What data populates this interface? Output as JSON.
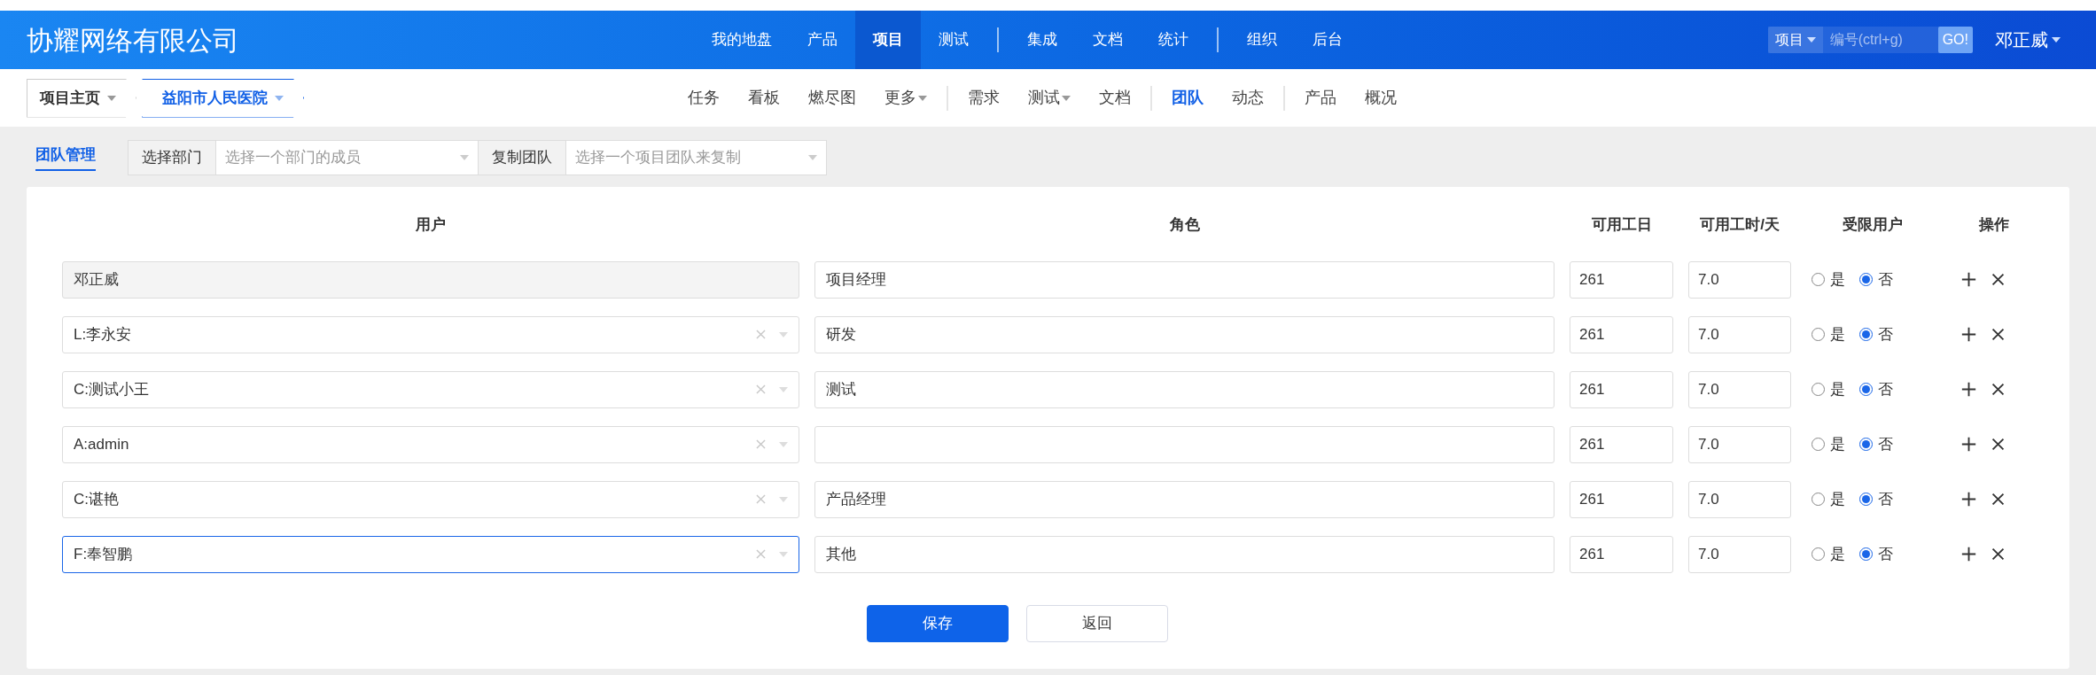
{
  "brand": "协耀网络有限公司",
  "main_nav": [
    [
      {
        "label": "我的地盘",
        "selected": false
      },
      {
        "label": "产品",
        "selected": false
      },
      {
        "label": "项目",
        "selected": true
      },
      {
        "label": "测试",
        "selected": false
      }
    ],
    [
      {
        "label": "集成",
        "selected": false
      },
      {
        "label": "文档",
        "selected": false
      },
      {
        "label": "统计",
        "selected": false
      }
    ],
    [
      {
        "label": "组织",
        "selected": false
      },
      {
        "label": "后台",
        "selected": false
      }
    ]
  ],
  "search": {
    "scope": "项目",
    "placeholder": "编号(ctrl+g)",
    "button": "GO!"
  },
  "user": "邓正威",
  "breadcrumb": [
    {
      "label": "项目主页",
      "selected": false
    },
    {
      "label": "益阳市人民医院",
      "selected": true
    }
  ],
  "sub_nav": [
    [
      {
        "label": "任务",
        "selected": false,
        "has_menu": false
      },
      {
        "label": "看板",
        "selected": false,
        "has_menu": false
      },
      {
        "label": "燃尽图",
        "selected": false,
        "has_menu": false
      },
      {
        "label": "更多",
        "selected": false,
        "has_menu": true
      }
    ],
    [
      {
        "label": "需求",
        "selected": false,
        "has_menu": false
      },
      {
        "label": "测试",
        "selected": false,
        "has_menu": true
      },
      {
        "label": "文档",
        "selected": false,
        "has_menu": false
      }
    ],
    [
      {
        "label": "团队",
        "selected": true,
        "has_menu": false
      },
      {
        "label": "动态",
        "selected": false,
        "has_menu": false
      }
    ],
    [
      {
        "label": "产品",
        "selected": false,
        "has_menu": false
      },
      {
        "label": "概况",
        "selected": false,
        "has_menu": false
      }
    ]
  ],
  "page_tab": {
    "label": "团队管理",
    "selected": true
  },
  "filters": [
    {
      "label": "选择部门",
      "placeholder": "选择一个部门的成员"
    },
    {
      "label": "复制团队",
      "placeholder": "选择一个项目团队来复制"
    }
  ],
  "table": {
    "columns": [
      "用户",
      "角色",
      "可用工日",
      "可用工时/天",
      "受限用户",
      "操作"
    ],
    "rows": [
      {
        "user": "邓正威",
        "disabled": true,
        "focused": false,
        "role": "项目经理",
        "days": "261",
        "hours": "7.0",
        "limited": [
          {
            "label": "是",
            "selected": false
          },
          {
            "label": "否",
            "selected": true
          }
        ]
      },
      {
        "user": "L:李永安",
        "disabled": false,
        "focused": false,
        "role": "研发",
        "days": "261",
        "hours": "7.0",
        "limited": [
          {
            "label": "是",
            "selected": false
          },
          {
            "label": "否",
            "selected": true
          }
        ]
      },
      {
        "user": "C:测试小王",
        "disabled": false,
        "focused": false,
        "role": "测试",
        "days": "261",
        "hours": "7.0",
        "limited": [
          {
            "label": "是",
            "selected": false
          },
          {
            "label": "否",
            "selected": true
          }
        ]
      },
      {
        "user": "A:admin",
        "disabled": false,
        "focused": false,
        "days": "261",
        "hours": "7.0",
        "limited": [
          {
            "label": "是",
            "selected": false
          },
          {
            "label": "否",
            "selected": true
          }
        ]
      },
      {
        "user": "C:谌艳",
        "disabled": false,
        "focused": false,
        "role": "产品经理",
        "days": "261",
        "hours": "7.0",
        "limited": [
          {
            "label": "是",
            "selected": false
          },
          {
            "label": "否",
            "selected": true
          }
        ]
      },
      {
        "user": "F:奉智鹏",
        "disabled": false,
        "focused": true,
        "role": "其他",
        "days": "261",
        "hours": "7.0",
        "limited": [
          {
            "label": "是",
            "selected": false
          },
          {
            "label": "否",
            "selected": true
          }
        ]
      }
    ]
  },
  "buttons": [
    {
      "label": "保存",
      "kind": "primary"
    },
    {
      "label": "返回",
      "kind": "default"
    }
  ]
}
